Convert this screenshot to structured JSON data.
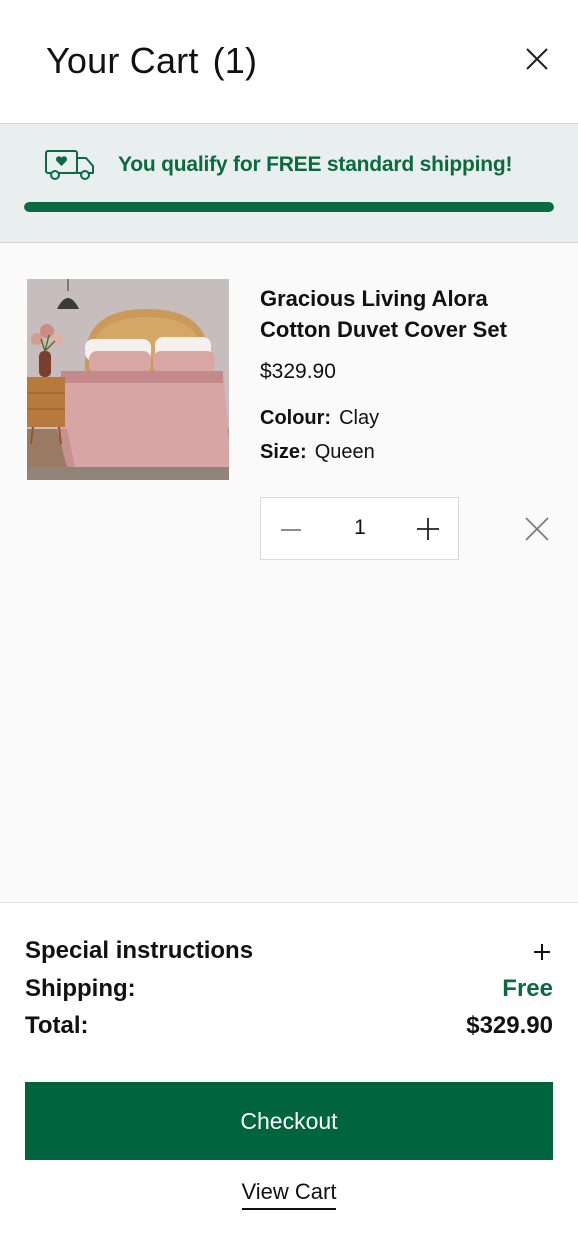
{
  "header": {
    "title": "Your Cart",
    "count": "(1)"
  },
  "shipping_banner": {
    "message": "You qualify for FREE standard shipping!",
    "progress_percent": 100,
    "color": "#0b6b3f"
  },
  "cart_item": {
    "title": "Gracious Living Alora Cotton Duvet Cover Set",
    "price": "$329.90",
    "colour_label": "Colour:",
    "colour_value": "Clay",
    "size_label": "Size:",
    "size_value": "Queen",
    "quantity": "1"
  },
  "summary": {
    "instructions_label": "Special instructions",
    "shipping_label": "Shipping:",
    "shipping_value": "Free",
    "total_label": "Total:",
    "total_value": "$329.90"
  },
  "actions": {
    "checkout_label": "Checkout",
    "view_cart_label": "View Cart"
  },
  "colors": {
    "brand_green": "#00653f",
    "banner_bg": "#e9efee"
  },
  "icons": [
    "close-icon",
    "delivery-truck-heart-icon",
    "minus-icon",
    "plus-icon",
    "remove-icon"
  ]
}
